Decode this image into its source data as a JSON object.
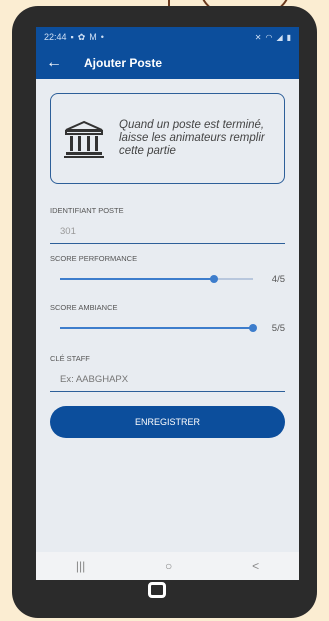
{
  "statusbar": {
    "time": "22:44",
    "notification_icons": [
      "gallery-icon",
      "settings-icon",
      "gmail-icon",
      "dot-icon"
    ],
    "system_icons": [
      "mute-icon",
      "wifi-icon",
      "signal-icon",
      "battery-icon"
    ]
  },
  "appbar": {
    "title": "Ajouter Poste"
  },
  "info_card": {
    "icon": "building-icon",
    "text": "Quand un poste est terminé, laisse les animateurs remplir cette partie"
  },
  "form": {
    "id_label": "IDENTIFIANT POSTE",
    "id_value": "301",
    "perf_label": "SCORE PERFORMANCE",
    "perf_value_text": "4/5",
    "perf_fraction": 0.8,
    "ambiance_label": "SCORE AMBIANCE",
    "ambiance_value_text": "5/5",
    "ambiance_fraction": 1.0,
    "staff_label": "CLÉ STAFF",
    "staff_placeholder": "Ex: AABGHAPX",
    "save_label": "ENREGISTRER"
  },
  "navbar": {
    "recent": "|||",
    "home": "○",
    "back": "<"
  },
  "colors": {
    "primary": "#0c4e9c",
    "accent": "#3d7dcc",
    "background": "#e8ecf1"
  }
}
